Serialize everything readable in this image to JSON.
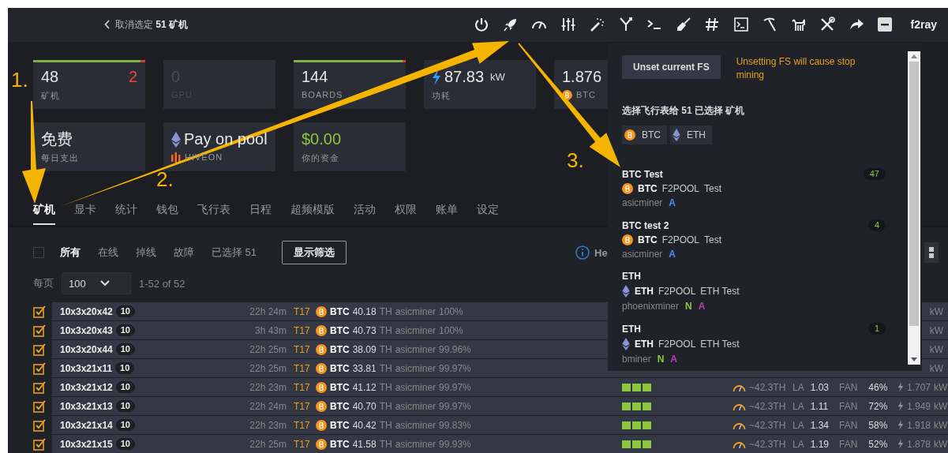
{
  "top_bar": {
    "back_label": "取消选定 **51 矿机**",
    "user": "f2ray"
  },
  "stats": {
    "row_1": [
      {
        "kind": "count",
        "value": "48",
        "alert": "2",
        "label": "矿机",
        "level": 0.96,
        "disabled": false
      },
      {
        "kind": "count",
        "value": "0",
        "label": "GPU",
        "disabled": true
      },
      {
        "kind": "count",
        "value": "144",
        "label": "BOARDS",
        "level": 0.97,
        "disabled": false
      },
      {
        "kind": "power",
        "value": "87.83",
        "unit": "kW",
        "label": "功耗",
        "disabled": false
      },
      {
        "kind": "coin",
        "value": "1.876",
        "label": "BTC",
        "disabled": false
      }
    ],
    "row_2": [
      {
        "kind": "plain",
        "value": "免费",
        "label": "每日支出",
        "disabled": false
      },
      {
        "kind": "pool",
        "value": "Pay on pool",
        "label": "HIVEON",
        "disabled": false
      },
      {
        "kind": "money",
        "value": "$0.00",
        "label": "你的资金",
        "disabled": false
      }
    ]
  },
  "tabs": [
    {
      "label": "矿机",
      "selected": true
    },
    {
      "label": "显卡",
      "selected": false
    },
    {
      "label": "统计",
      "selected": false
    },
    {
      "label": "钱包",
      "selected": false
    },
    {
      "label": "飞行表",
      "selected": false
    },
    {
      "label": "日程",
      "selected": false
    },
    {
      "label": "超频模版",
      "selected": false
    },
    {
      "label": "活动",
      "selected": false
    },
    {
      "label": "权限",
      "selected": false
    },
    {
      "label": "账单",
      "selected": false
    },
    {
      "label": "设定",
      "selected": false
    }
  ],
  "select_all": {
    "checked": false
  },
  "filters": [
    {
      "label": "所有",
      "selected": true
    },
    {
      "label": "在线",
      "selected": false
    },
    {
      "label": "掉线",
      "selected": false
    },
    {
      "label": "故障",
      "selected": false
    },
    {
      "label": "已选择 51",
      "selected": false
    }
  ],
  "filter_button": "显示筛选",
  "help_link": "He",
  "per_page_label": "每页",
  "per_page": "100",
  "range": "1-52 of 52",
  "rows": [
    {
      "checked": true,
      "name": "10x3x20x42",
      "badge": "10",
      "uptime": "22h 24m",
      "model": "T17",
      "coin": "BTC",
      "hashrate": "40.18",
      "unit": "TH",
      "miner": "asicminer",
      "share": "100%",
      "power_unit": "kW"
    },
    {
      "checked": true,
      "name": "10x3x20x43",
      "badge": "10",
      "uptime": "3h 43m",
      "model": "T17",
      "coin": "BTC",
      "hashrate": "40.73",
      "unit": "TH",
      "miner": "asicminer",
      "share": "100%",
      "power_unit": "kW"
    },
    {
      "checked": true,
      "name": "10x3x20x44",
      "badge": "10",
      "uptime": "22h 25m",
      "model": "T17",
      "coin": "BTC",
      "hashrate": "38.09",
      "unit": "TH",
      "miner": "asicminer",
      "share": "99.96%",
      "power_unit": "kW"
    },
    {
      "checked": true,
      "name": "10x3x21x11",
      "badge": "10",
      "uptime": "22h 25m",
      "model": "T17",
      "coin": "BTC",
      "hashrate": "33.81",
      "unit": "TH",
      "miner": "asicminer",
      "share": "99.97%",
      "power_unit": "kW"
    },
    {
      "checked": true,
      "name": "10x3x21x12",
      "badge": "10",
      "uptime": "22h 23m",
      "model": "T17",
      "coin": "BTC",
      "hashrate": "41.12",
      "unit": "TH",
      "miner": "asicminer",
      "share": "99.97%",
      "boards": [
        {
          "ok": true
        },
        {
          "ok": true
        },
        {
          "ok": true
        }
      ],
      "est_hashrate": "~42.3TH",
      "la_label": "LA",
      "la": "1.03",
      "fan_label": "FAN",
      "fan": "46%",
      "power": "1.707",
      "power_unit": "kW"
    },
    {
      "checked": true,
      "name": "10x3x21x13",
      "badge": "10",
      "uptime": "22h 24m",
      "model": "T17",
      "coin": "BTC",
      "hashrate": "40.70",
      "unit": "TH",
      "miner": "asicminer",
      "share": "99.97%",
      "boards": [
        {
          "ok": true
        },
        {
          "ok": true
        },
        {
          "ok": true
        }
      ],
      "est_hashrate": "~42.3TH",
      "la_label": "LA",
      "la": "1.11",
      "fan_label": "FAN",
      "fan": "72%",
      "power": "1.949",
      "power_unit": "kW"
    },
    {
      "checked": true,
      "name": "10x3x21x14",
      "badge": "10",
      "uptime": "22h 23m",
      "model": "T17",
      "coin": "BTC",
      "hashrate": "40.42",
      "unit": "TH",
      "miner": "asicminer",
      "share": "99.83%",
      "boards": [
        {
          "ok": true
        },
        {
          "ok": true
        },
        {
          "ok": true
        }
      ],
      "est_hashrate": "~42.3TH",
      "la_label": "LA",
      "la": "1.34",
      "fan_label": "FAN",
      "fan": "58%",
      "power": "1.918",
      "power_unit": "kW"
    },
    {
      "checked": true,
      "name": "10x3x21x15",
      "badge": "10",
      "uptime": "22h 25m",
      "model": "T17",
      "coin": "BTC",
      "hashrate": "41.58",
      "unit": "TH",
      "miner": "asicminer",
      "share": "99.93%",
      "boards": [
        {
          "ok": true
        },
        {
          "ok": true
        },
        {
          "ok": true
        }
      ],
      "est_hashrate": "~42.3TH",
      "la_label": "LA",
      "la": "1.19",
      "fan_label": "FAN",
      "fan": "52%",
      "power": "1.878",
      "power_unit": "kW"
    }
  ],
  "flight_sheet_menu": {
    "unset_button": "Unset current FS",
    "warning": "Unsetting FS will cause stop mining",
    "title": "选择飞行表给 51 已选择 矿机",
    "coin_filters": [
      {
        "kind": "btc",
        "label": "BTC"
      },
      {
        "kind": "eth",
        "label": "ETH"
      }
    ],
    "flight_sheets": [
      {
        "name": "BTC Test",
        "count": "47",
        "kind": "btc",
        "coin": "BTC",
        "pool": "F2POOL",
        "wallet": "Test",
        "miner": "asicminer",
        "tags": [
          {
            "label": "A",
            "color": "#4a8cff"
          }
        ]
      },
      {
        "name": "BTC test 2",
        "count": "4",
        "kind": "btc",
        "coin": "BTC",
        "pool": "F2POOL",
        "wallet": "Test",
        "miner": "asicminer",
        "tags": [
          {
            "label": "A",
            "color": "#4a8cff"
          }
        ]
      },
      {
        "name": "ETH",
        "kind": "eth",
        "coin": "ETH",
        "pool": "F2POOL",
        "wallet": "ETH Test",
        "miner": "phoenixminer",
        "tags": [
          {
            "label": "N",
            "color": "#8dc63f"
          },
          {
            "label": "A",
            "color": "#c03cb4"
          }
        ]
      },
      {
        "name": "ETH",
        "count": "1",
        "kind": "eth",
        "coin": "ETH",
        "pool": "F2POOL",
        "wallet": "ETH Test",
        "miner": "bminer",
        "tags": [
          {
            "label": "N",
            "color": "#8dc63f"
          },
          {
            "label": "A",
            "color": "#c03cb4"
          }
        ]
      }
    ]
  },
  "annotations": [
    {
      "label": "1."
    },
    {
      "label": "2."
    },
    {
      "label": "3."
    }
  ]
}
